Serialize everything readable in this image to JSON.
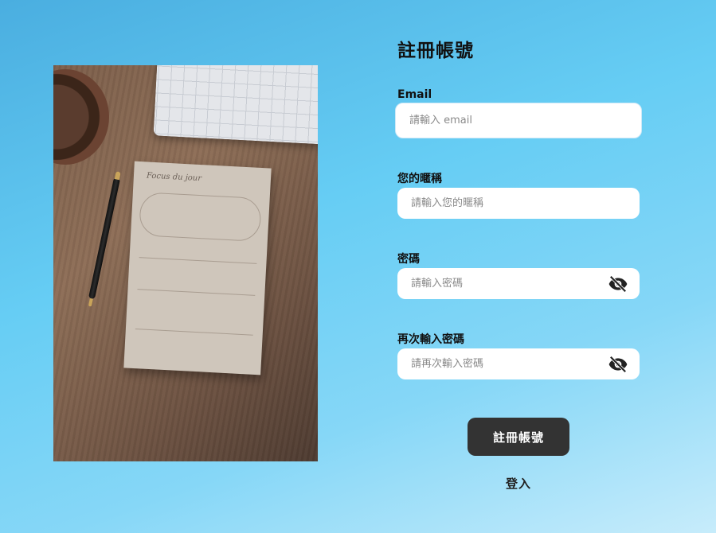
{
  "form": {
    "title": "註冊帳號",
    "fields": {
      "email": {
        "label": "Email",
        "placeholder": "請輸入 email",
        "value": ""
      },
      "nickname": {
        "label": "您的暱稱",
        "placeholder": "請輸入您的暱稱",
        "value": ""
      },
      "password": {
        "label": "密碼",
        "placeholder": "請輸入密碼",
        "value": "",
        "icon": "eye-off-icon"
      },
      "confirm_password": {
        "label": "再次輸入密碼",
        "placeholder": "請再次輸入密碼",
        "value": "",
        "icon": "eye-off-icon"
      }
    },
    "submit_label": "註冊帳號",
    "login_label": "登入"
  },
  "photo": {
    "notepad_title": "Focus du jour"
  },
  "colors": {
    "background_start": "#4aaee0",
    "background_end": "#c7ecfb",
    "button": "#333333",
    "input_bg": "#ffffff"
  }
}
